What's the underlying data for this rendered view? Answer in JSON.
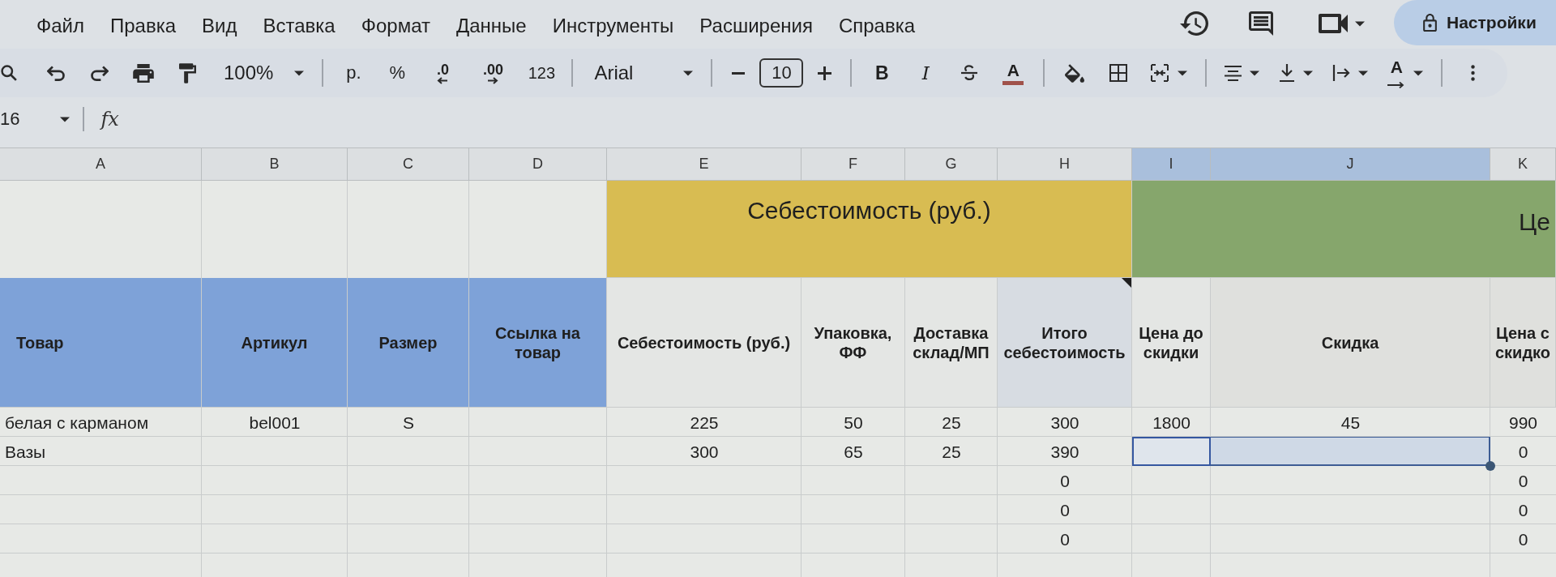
{
  "menu": [
    "Файл",
    "Правка",
    "Вид",
    "Вставка",
    "Формат",
    "Данные",
    "Инструменты",
    "Расширения",
    "Справка"
  ],
  "share_button": {
    "label": "Настройки"
  },
  "toolbar": {
    "zoom": "100%",
    "currency": "р.",
    "percent": "%",
    "decrease_decimals": ".0",
    "increase_decimals": ".00",
    "number_format": "123",
    "font": "Arial",
    "font_size": "10",
    "bold": "B",
    "italic": "I",
    "text_color": "A",
    "text_rotation": "A"
  },
  "formula_bar": {
    "cell_ref": "16",
    "function_label": "fx"
  },
  "table": {
    "columns": [
      {
        "letter": "A",
        "selected": false
      },
      {
        "letter": "B",
        "selected": false
      },
      {
        "letter": "C",
        "selected": false
      },
      {
        "letter": "D",
        "selected": false
      },
      {
        "letter": "E",
        "selected": false
      },
      {
        "letter": "F",
        "selected": false
      },
      {
        "letter": "G",
        "selected": false
      },
      {
        "letter": "H",
        "selected": false
      },
      {
        "letter": "I",
        "selected": true
      },
      {
        "letter": "J",
        "selected": true
      },
      {
        "letter": "K",
        "selected": false
      }
    ],
    "group_headers": [
      {
        "label": "Себестоимость (руб.)",
        "color": "#d8bc52"
      },
      {
        "label": "Це",
        "color": "#86a66c"
      }
    ],
    "headers": [
      {
        "label": "Товар",
        "color": "#7ea2d8",
        "note": false
      },
      {
        "label": "Артикул",
        "color": "#7ea2d8",
        "note": false
      },
      {
        "label": "Размер",
        "color": "#7ea2d8",
        "note": false
      },
      {
        "label": "Ссылка на товар",
        "color": "#7ea2d8",
        "note": false
      },
      {
        "label": "Себестоимость (руб.)",
        "color": "#e4e6e4",
        "note": false
      },
      {
        "label": "Упаковка, ФФ",
        "color": "#e4e6e4",
        "note": false
      },
      {
        "label": "Доставка склад/МП",
        "color": "#e4e6e4",
        "note": false
      },
      {
        "label": "Итого себестоимость",
        "color": "#d7dce2",
        "note": true
      },
      {
        "label": "Цена до скидки",
        "color": "#e4e6e4",
        "note": false
      },
      {
        "label": "Скидка",
        "color": "#dfe0dd",
        "note": false
      },
      {
        "label": "Цена с скидко",
        "color": "#dfe0dd",
        "note": false
      }
    ],
    "rows": [
      {
        "selected": false,
        "cells": {
          "product": "белая с карманом",
          "sku": "bel001",
          "size": "S",
          "cost": "225",
          "packaging": "50",
          "delivery": "25",
          "total_cost": "300",
          "price_before_discount": "1800",
          "discount": "45",
          "column_11": "990"
        }
      },
      {
        "selected": true,
        "cells": {
          "product": "Вазы",
          "cost": "300",
          "packaging": "65",
          "delivery": "25",
          "total_cost": "390",
          "column_11": "0"
        }
      },
      {
        "selected": false,
        "cells": {
          "total_cost": "0",
          "column_11": "0"
        }
      },
      {
        "selected": false,
        "cells": {
          "total_cost": "0",
          "column_11": "0"
        }
      },
      {
        "selected": false,
        "cells": {
          "total_cost": "0",
          "column_11": "0"
        }
      }
    ]
  }
}
